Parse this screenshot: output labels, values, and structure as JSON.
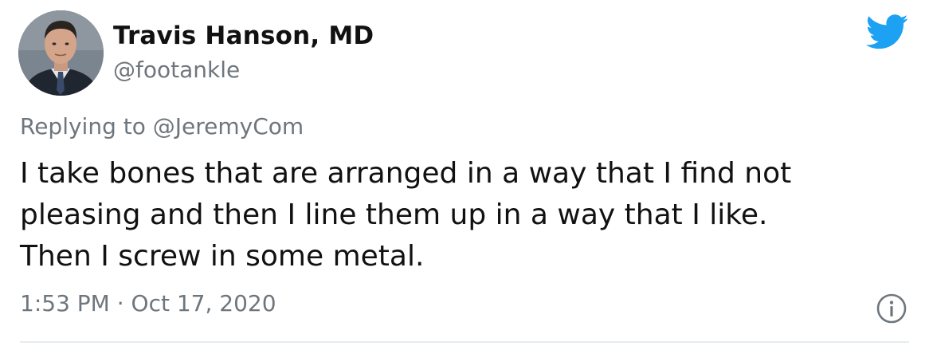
{
  "tweet": {
    "author": {
      "display_name": "Travis Hanson, MD",
      "handle": "@footankle"
    },
    "reply": {
      "prefix": "Replying to ",
      "to_handle": "@JeremyCom"
    },
    "text_lines": [
      "I take bones that are arranged in a way that I find not",
      "pleasing and then I line them up in a way that I like.",
      "Then I screw in some metal."
    ],
    "time": "1:53 PM",
    "separator": "·",
    "date": "Oct 17, 2020",
    "icons": {
      "brand": "twitter-bird-icon",
      "info": "info-icon"
    },
    "colors": {
      "twitter_blue": "#1da1f2",
      "secondary_text": "#6e767d",
      "primary_text": "#111111",
      "divider": "#e6ecf0"
    }
  }
}
